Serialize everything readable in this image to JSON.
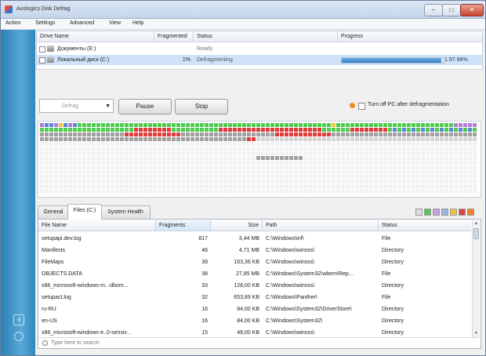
{
  "window": {
    "title": "Auslogics Disk Defrag",
    "min_glyph": "–",
    "max_glyph": "□",
    "close_glyph": "✕"
  },
  "menu": [
    "Action",
    "Settings",
    "Advanced",
    "View",
    "Help"
  ],
  "drives": {
    "columns": [
      "Drive Name",
      "Fragmented",
      "Status",
      "Progress"
    ],
    "rows": [
      {
        "name": "Документы (E:)",
        "fragmented": "",
        "status": "Ready",
        "progress": "",
        "progress_value": null,
        "selected": false
      },
      {
        "name": "Локальный диск (C:)",
        "fragmented": "1%",
        "status": "Defragmenting",
        "progress": "1.97.98%",
        "progress_value": 0.98,
        "selected": true
      }
    ]
  },
  "controls": {
    "combo_value": "Defrag",
    "combo_arrow_icon": "chevron-down-icon",
    "pause_label": "Pause",
    "stop_label": "Stop",
    "turnoff_label": "Turn off PC after defragmentation",
    "turnoff_checked": false,
    "warn_icon": "warning-icon"
  },
  "cluster_map": {
    "colors": {
      "free": "#4ecb4e",
      "fragmented": "#e03b3b",
      "used": "#5c86d6",
      "gray": "#a0a0a0",
      "empty": "#f2f2f2",
      "mft": "#b07cd6",
      "cur": "#f0c23a"
    }
  },
  "tabs": [
    "General",
    "Files (C:)",
    "System Health"
  ],
  "active_tab": 1,
  "legend_colors": [
    "#dddddd",
    "#55c855",
    "#c8a0e0",
    "#9db4e8",
    "#f0c040",
    "#e04040",
    "#f08030"
  ],
  "files": {
    "columns": [
      "File Name",
      "Fragments",
      "Size",
      "Path",
      "Status"
    ],
    "rows": [
      {
        "name": "setupapi.dev.log",
        "fragments": "817",
        "size": "3,44 MB",
        "path": "C:\\Windows\\inf\\",
        "status": "File"
      },
      {
        "name": "Manifests",
        "fragments": "46",
        "size": "4,71 MB",
        "path": "C:\\Windows\\winsxs\\",
        "status": "Directory"
      },
      {
        "name": "FileMaps",
        "fragments": "39",
        "size": "163,36 KB",
        "path": "C:\\Windows\\winsxs\\",
        "status": "Directory"
      },
      {
        "name": "OBJECTS.DATA",
        "fragments": "38",
        "size": "27,85 MB",
        "path": "C:\\Windows\\System32\\wbem\\Rep...",
        "status": "File"
      },
      {
        "name": "x86_microsoft-windows-m..-dbom...",
        "fragments": "33",
        "size": "128,00 KB",
        "path": "C:\\Windows\\winsxs\\",
        "status": "Directory"
      },
      {
        "name": "setupact.log",
        "fragments": "32",
        "size": "653,89 KB",
        "path": "C:\\Windows\\Panther\\",
        "status": "File"
      },
      {
        "name": "ru-RU",
        "fragments": "16",
        "size": "84,00 KB",
        "path": "C:\\Windows\\System32\\DriverStore\\",
        "status": "Directory"
      },
      {
        "name": "en-US",
        "fragments": "16",
        "size": "84,00 KB",
        "path": "C:\\Windows\\System32\\",
        "status": "Directory"
      },
      {
        "name": "x86_microsoft-windows-e..0-sensiv...",
        "fragments": "15",
        "size": "48,00 KB",
        "path": "C:\\Windows\\winsxs\\",
        "status": "Directory"
      }
    ]
  },
  "search": {
    "placeholder": "Type here to search"
  }
}
